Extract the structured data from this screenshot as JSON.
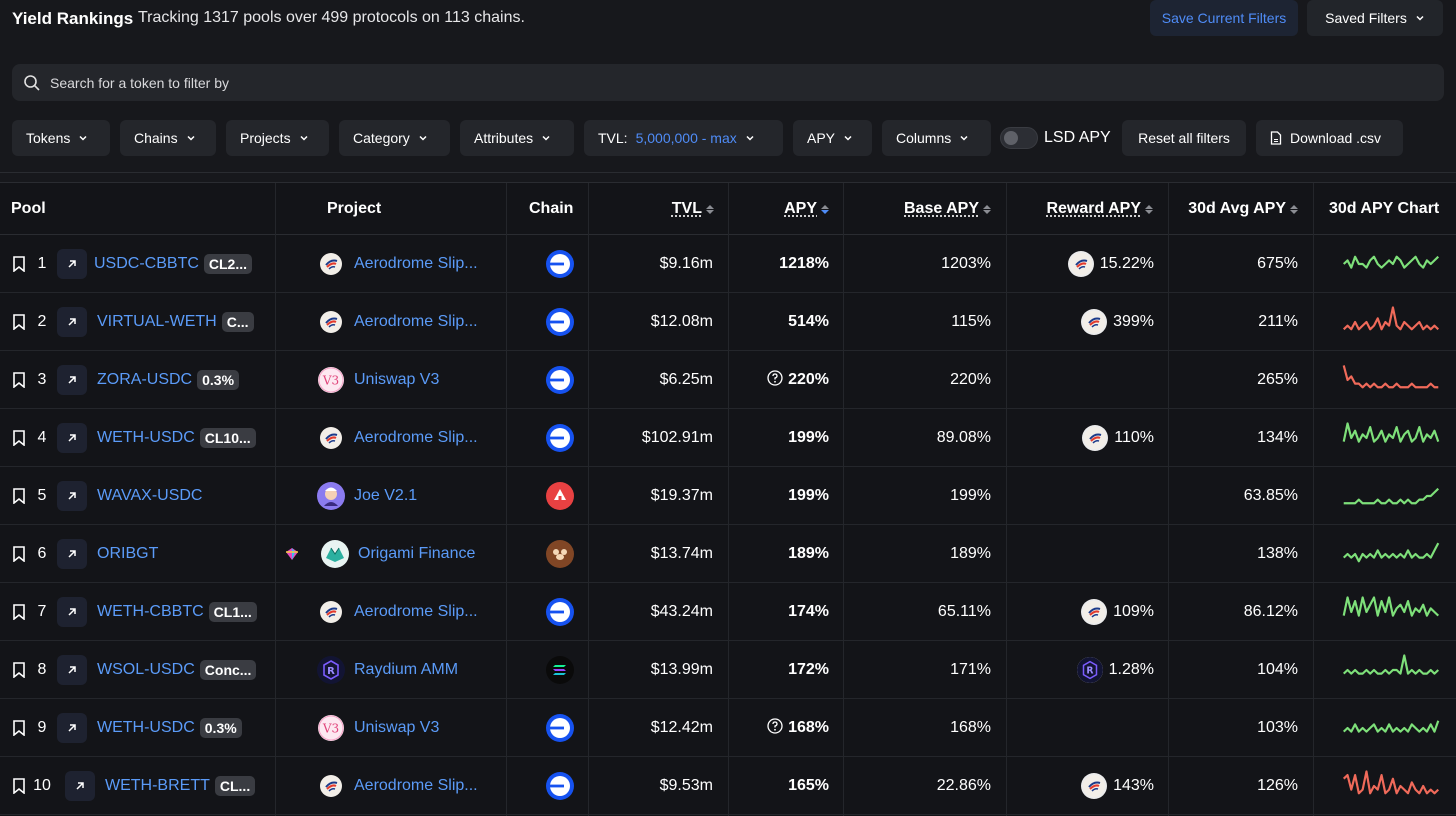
{
  "header": {
    "title": "Yield Rankings",
    "subtitle": "Tracking 1317 pools over 499 protocols on 113 chains.",
    "save_filters": "Save Current Filters",
    "saved_filters": "Saved Filters"
  },
  "search": {
    "placeholder": "Search for a token to filter by"
  },
  "filters": {
    "tokens": "Tokens",
    "chains": "Chains",
    "projects": "Projects",
    "category": "Category",
    "attributes": "Attributes",
    "tvl_label": "TVL:",
    "tvl_value": "5,000,000 - max",
    "apy": "APY",
    "columns": "Columns",
    "lsd_apy": "LSD APY",
    "reset": "Reset all filters",
    "download": "Download .csv"
  },
  "colors": {
    "accent": "#4f8cf7",
    "green_sparkline": "#7ee07a",
    "red_sparkline": "#f06a5a"
  },
  "table": {
    "columns": {
      "pool": "Pool",
      "project": "Project",
      "chain": "Chain",
      "tvl": "TVL",
      "apy": "APY",
      "base_apy": "Base APY",
      "reward_apy": "Reward APY",
      "avg30": "30d Avg APY",
      "chart30": "30d APY Chart"
    },
    "rows": [
      {
        "rank": "1",
        "pool": "USDC-CBBTC",
        "badge": "CL2...",
        "project": "Aerodrome Slip...",
        "logo": "aerodrome",
        "chain": "base",
        "tvl": "$9.16m",
        "apy": "1218%",
        "apy_q": false,
        "base": "1203%",
        "reward": "15.22%",
        "reward_logo": "aerodrome",
        "avg": "675%",
        "trend": "green",
        "spark": [
          5,
          6,
          4,
          7,
          5,
          5,
          4,
          6,
          7,
          5,
          4,
          5,
          6,
          5,
          7,
          6,
          4,
          5,
          6,
          7,
          5,
          4,
          6,
          5,
          6,
          7
        ]
      },
      {
        "rank": "2",
        "pool": "VIRTUAL-WETH",
        "badge": "C...",
        "project": "Aerodrome Slip...",
        "logo": "aerodrome",
        "chain": "base",
        "tvl": "$12.08m",
        "apy": "514%",
        "apy_q": false,
        "base": "115%",
        "reward": "399%",
        "reward_logo": "aerodrome",
        "avg": "211%",
        "trend": "red",
        "spark": [
          3,
          4,
          3,
          5,
          3,
          4,
          5,
          3,
          4,
          6,
          3,
          5,
          4,
          9,
          4,
          3,
          5,
          4,
          3,
          4,
          5,
          3,
          4,
          3,
          4,
          3
        ]
      },
      {
        "rank": "3",
        "pool": "ZORA-USDC",
        "badge": "0.3%",
        "project": "Uniswap V3",
        "logo": "uniswap",
        "chain": "base",
        "tvl": "$6.25m",
        "apy": "220%",
        "apy_q": true,
        "base": "220%",
        "reward": "",
        "reward_logo": "",
        "avg": "265%",
        "trend": "red",
        "spark": [
          9,
          5,
          6,
          4,
          4,
          3,
          4,
          3,
          4,
          3,
          3,
          4,
          3,
          3,
          4,
          3,
          3,
          3,
          4,
          3,
          3,
          3,
          3,
          4,
          3,
          3
        ]
      },
      {
        "rank": "4",
        "pool": "WETH-USDC",
        "badge": "CL10...",
        "project": "Aerodrome Slip...",
        "logo": "aerodrome",
        "chain": "base",
        "tvl": "$102.91m",
        "apy": "199%",
        "apy_q": false,
        "base": "89.08%",
        "reward": "110%",
        "reward_logo": "aerodrome",
        "avg": "134%",
        "trend": "green",
        "spark": [
          4,
          9,
          5,
          7,
          4,
          6,
          5,
          8,
          4,
          5,
          7,
          4,
          6,
          5,
          8,
          4,
          6,
          7,
          4,
          5,
          8,
          4,
          6,
          5,
          7,
          4
        ]
      },
      {
        "rank": "5",
        "pool": "WAVAX-USDC",
        "badge": "",
        "project": "Joe V2.1",
        "logo": "joe",
        "chain": "avax",
        "tvl": "$19.37m",
        "apy": "199%",
        "apy_q": false,
        "base": "199%",
        "reward": "",
        "reward_logo": "",
        "avg": "63.85%",
        "trend": "green",
        "spark": [
          3,
          3,
          3,
          3,
          4,
          3,
          3,
          3,
          3,
          4,
          3,
          3,
          4,
          3,
          3,
          4,
          3,
          4,
          3,
          3,
          4,
          4,
          5,
          5,
          6,
          7
        ]
      },
      {
        "rank": "6",
        "pool": "ORIBGT",
        "badge": "",
        "project": "Origami Finance",
        "logo": "origami",
        "chain": "bera",
        "tvl": "$13.74m",
        "apy": "189%",
        "apy_q": false,
        "base": "189%",
        "reward": "",
        "reward_logo": "",
        "avg": "138%",
        "trend": "green",
        "spark": [
          4,
          5,
          4,
          5,
          3,
          5,
          4,
          5,
          4,
          6,
          4,
          5,
          4,
          5,
          4,
          5,
          4,
          6,
          4,
          5,
          4,
          4,
          5,
          4,
          6,
          8
        ]
      },
      {
        "rank": "7",
        "pool": "WETH-CBBTC",
        "badge": "CL1...",
        "project": "Aerodrome Slip...",
        "logo": "aerodrome",
        "chain": "base",
        "tvl": "$43.24m",
        "apy": "174%",
        "apy_q": false,
        "base": "65.11%",
        "reward": "109%",
        "reward_logo": "aerodrome",
        "avg": "86.12%",
        "trend": "green",
        "spark": [
          4,
          9,
          5,
          8,
          4,
          9,
          5,
          7,
          9,
          4,
          8,
          5,
          9,
          4,
          6,
          7,
          5,
          8,
          4,
          6,
          5,
          7,
          4,
          6,
          5,
          4
        ]
      },
      {
        "rank": "8",
        "pool": "WSOL-USDC",
        "badge": "Conc...",
        "project": "Raydium AMM",
        "logo": "raydium",
        "chain": "sol",
        "tvl": "$13.99m",
        "apy": "172%",
        "apy_q": false,
        "base": "171%",
        "reward": "1.28%",
        "reward_logo": "raydium",
        "avg": "104%",
        "trend": "green",
        "spark": [
          4,
          5,
          4,
          5,
          4,
          4,
          5,
          4,
          5,
          4,
          4,
          5,
          4,
          5,
          5,
          4,
          9,
          4,
          5,
          4,
          5,
          4,
          4,
          5,
          4,
          5
        ]
      },
      {
        "rank": "9",
        "pool": "WETH-USDC",
        "badge": "0.3%",
        "project": "Uniswap V3",
        "logo": "uniswap",
        "chain": "base",
        "tvl": "$12.42m",
        "apy": "168%",
        "apy_q": true,
        "base": "168%",
        "reward": "",
        "reward_logo": "",
        "avg": "103%",
        "trend": "green",
        "spark": [
          4,
          5,
          4,
          6,
          4,
          5,
          4,
          5,
          6,
          4,
          5,
          4,
          6,
          4,
          5,
          4,
          5,
          4,
          6,
          5,
          4,
          5,
          4,
          6,
          4,
          7
        ]
      },
      {
        "rank": "10",
        "pool": "WETH-BRETT",
        "badge": "CL...",
        "project": "Aerodrome Slip...",
        "logo": "aerodrome",
        "chain": "base",
        "tvl": "$9.53m",
        "apy": "165%",
        "apy_q": false,
        "base": "22.86%",
        "reward": "143%",
        "reward_logo": "aerodrome",
        "avg": "126%",
        "trend": "red",
        "spark": [
          7,
          8,
          4,
          8,
          3,
          4,
          9,
          3,
          5,
          4,
          8,
          3,
          4,
          7,
          3,
          5,
          4,
          3,
          6,
          4,
          3,
          5,
          3,
          4,
          3,
          4
        ]
      }
    ]
  }
}
